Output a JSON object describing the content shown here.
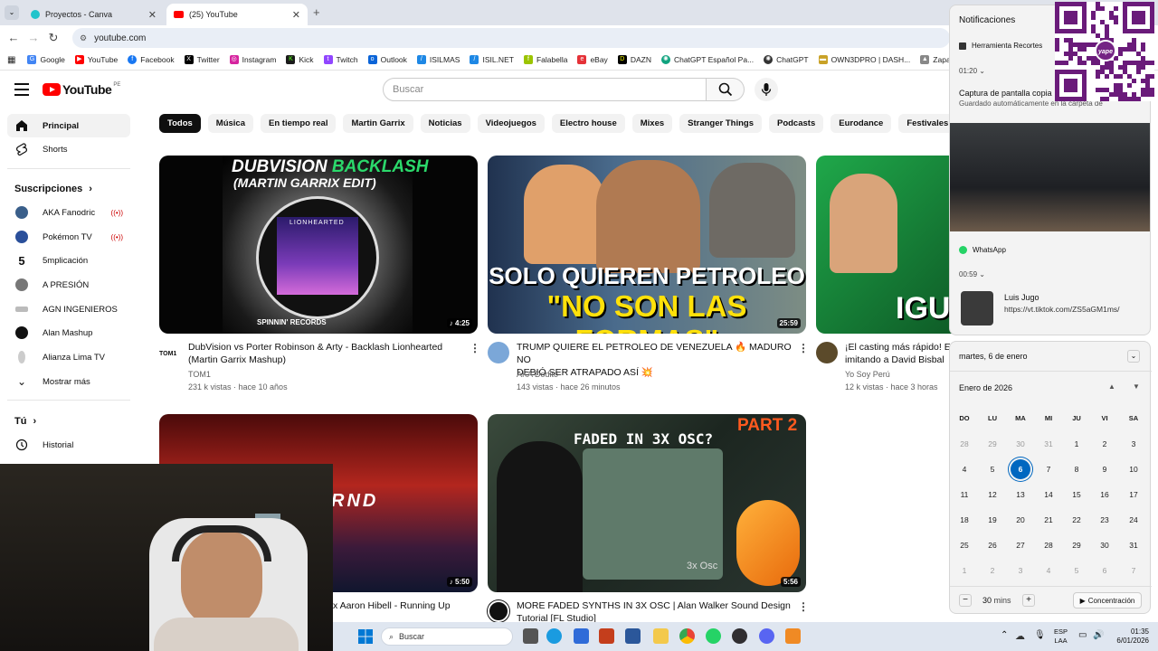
{
  "browser": {
    "tabs": [
      {
        "title": "Proyectos - Canva"
      },
      {
        "title": "(25) YouTube"
      }
    ],
    "url": "youtube.com",
    "bookmarks": [
      "Google",
      "YouTube",
      "Facebook",
      "Twitter",
      "Instagram",
      "Kick",
      "Twitch",
      "Outlook",
      "ISILMAS",
      "ISIL.NET",
      "Falabella",
      "eBay",
      "DAZN",
      "ChatGPT Español Pa...",
      "ChatGPT",
      "OWN3DPRO | DASH...",
      "Zapatillas y ropa"
    ]
  },
  "youtube": {
    "logo_text": "YouTube",
    "region": "PE",
    "search_placeholder": "Buscar",
    "sidebar": {
      "main": [
        {
          "label": "Principal"
        },
        {
          "label": "Shorts"
        }
      ],
      "subs_title": "Suscripciones",
      "subs": [
        {
          "label": "AKA Fanodric",
          "live": "((•))",
          "color": "#3a5f8a"
        },
        {
          "label": "Pokémon TV",
          "live": "((•))",
          "color": "#2a4f9a"
        },
        {
          "label": "5mplicación",
          "live": "",
          "color": "#222222"
        },
        {
          "label": "A PRESIÓN",
          "live": "",
          "color": "#777777"
        },
        {
          "label": "AGN INGENIEROS",
          "live": "",
          "color": "#999999"
        },
        {
          "label": "Alan Mashup",
          "live": "",
          "color": "#111111"
        },
        {
          "label": "Alianza Lima TV",
          "live": "",
          "color": "#cccccc"
        }
      ],
      "more": "Mostrar más",
      "you_title": "Tú",
      "history": "Historial"
    },
    "chips": [
      "Todos",
      "Música",
      "En tiempo real",
      "Martin Garrix",
      "Noticias",
      "Videojuegos",
      "Electro house",
      "Mixes",
      "Stranger Things",
      "Podcasts",
      "Eurodance",
      "Festivales de música"
    ],
    "videos": [
      {
        "title_l1": "DubVision vs Porter Robinson & Arty - Backlash Lionhearted",
        "title_l2": "(Martin Garrix Mashup)",
        "channel": "TOM1",
        "meta": "231 k vistas · hace 10 años",
        "duration": "♪ 4:25",
        "thumb_top": "DUBVISION",
        "thumb_top2": "BACKLASH",
        "thumb_sub": "(MARTIN GARRIX EDIT)",
        "thumb_center": "LIONHEARTED",
        "thumb_brand": "SPINNIN' RECORDS",
        "avatar_text": "TOM1"
      },
      {
        "title_l1": "TRUMP QUIERE EL PETROLEO DE VENEZUELA 🔥 MADURO NO",
        "title_l2": "DEBIÓ SER ATRAPADO ASÍ 💥",
        "channel": "AKA Dodito",
        "meta": "143 vistas · hace 26 minutos",
        "duration": "25:59",
        "thumb_l1": "SOLO QUIEREN PETROLEO",
        "thumb_l2": "\"NO SON LAS FORMAS\""
      },
      {
        "title_l1": "¡El casting más rápido! E",
        "title_l2": "imitando a David Bisbal",
        "channel": "Yo Soy Perú",
        "meta": "12 k vistas · hace 3 horas",
        "thumb_text": "IGU"
      },
      {
        "title_l1": "x Aaron Hibell - Running Up",
        "duration": "♪ 5:50",
        "thumb_text": "RND"
      },
      {
        "title_l1": "MORE FADED SYNTHS IN 3X OSC | Alan Walker Sound Design",
        "title_l2": "Tutorial [FL Studio]",
        "duration": "5:56",
        "thumb_l1": "FADED IN 3X OSC?",
        "thumb_part": "PART 2",
        "thumb_osc": "3x Osc"
      }
    ]
  },
  "notifications": {
    "title": "Notificaciones",
    "app1": "Herramienta Recortes",
    "time1": "01:20",
    "capture_title": "Captura de pantalla copia",
    "capture_body": "Guardado automáticamente en la carpeta de",
    "app2": "WhatsApp",
    "time2": "00:59",
    "sender": "Luis Jugo",
    "message": "https://vt.tiktok.com/ZS5aGM1ms/"
  },
  "calendar": {
    "date_header": "martes, 6 de enero",
    "month": "Enero de 2026",
    "weekdays": [
      "DO",
      "LU",
      "MA",
      "MI",
      "JU",
      "VI",
      "SA"
    ],
    "days": [
      [
        "28",
        "29",
        "30",
        "31",
        "1",
        "2",
        "3"
      ],
      [
        "4",
        "5",
        "6",
        "7",
        "8",
        "9",
        "10"
      ],
      [
        "11",
        "12",
        "13",
        "14",
        "15",
        "16",
        "17"
      ],
      [
        "18",
        "19",
        "20",
        "21",
        "22",
        "23",
        "24"
      ],
      [
        "25",
        "26",
        "27",
        "28",
        "29",
        "30",
        "31"
      ],
      [
        "1",
        "2",
        "3",
        "4",
        "5",
        "6",
        "7"
      ]
    ],
    "today": "6",
    "focus_minutes": "30",
    "focus_unit": "mins",
    "focus_button": "Concentración"
  },
  "qr": {
    "label": "yape"
  },
  "taskbar": {
    "search_placeholder": "Buscar",
    "lang": "ESP",
    "lang2": "LAA",
    "time": "01:35",
    "date": "6/01/2026"
  }
}
